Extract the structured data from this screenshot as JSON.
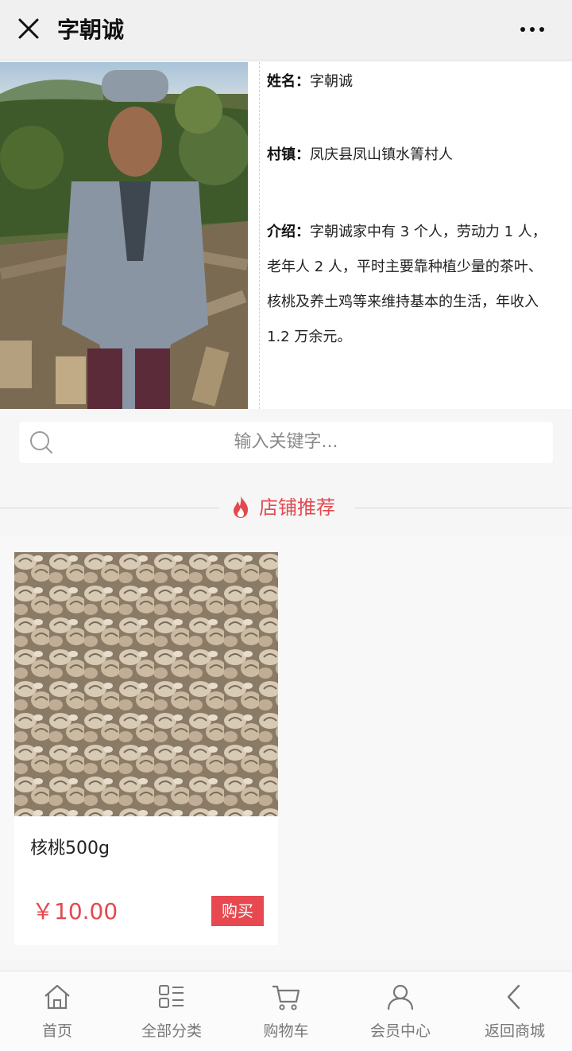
{
  "header": {
    "title": "字朝诚",
    "close_icon": "close-icon",
    "more_icon": "more-icon"
  },
  "profile": {
    "name_key": "姓名：",
    "name_value": "字朝诚",
    "village_key": "村镇：",
    "village_value": "凤庆县凤山镇水箐村人",
    "intro_key": "介绍：",
    "intro_line1": "字朝诚家中有 3 个人，劳动力 1 人，",
    "intro_line2": "老年人 2 人，平时主要靠种植少量的茶叶、",
    "intro_line3": "核桃及养土鸡等来维持基本的生活，年收入",
    "intro_line4": "1.2 万余元。"
  },
  "search": {
    "placeholder": "输入关键字..."
  },
  "recommend": {
    "title": "店铺推荐"
  },
  "products": [
    {
      "name": "核桃500g",
      "price": "￥10.00",
      "buy_label": "购买"
    }
  ],
  "bottom_nav": {
    "items": [
      {
        "label": "首页",
        "icon": "home-icon"
      },
      {
        "label": "全部分类",
        "icon": "category-icon"
      },
      {
        "label": "购物车",
        "icon": "cart-icon"
      },
      {
        "label": "会员中心",
        "icon": "user-icon"
      },
      {
        "label": "返回商城",
        "icon": "back-icon"
      }
    ]
  },
  "colors": {
    "accent": "#e4484f",
    "nav_text": "#777777"
  }
}
